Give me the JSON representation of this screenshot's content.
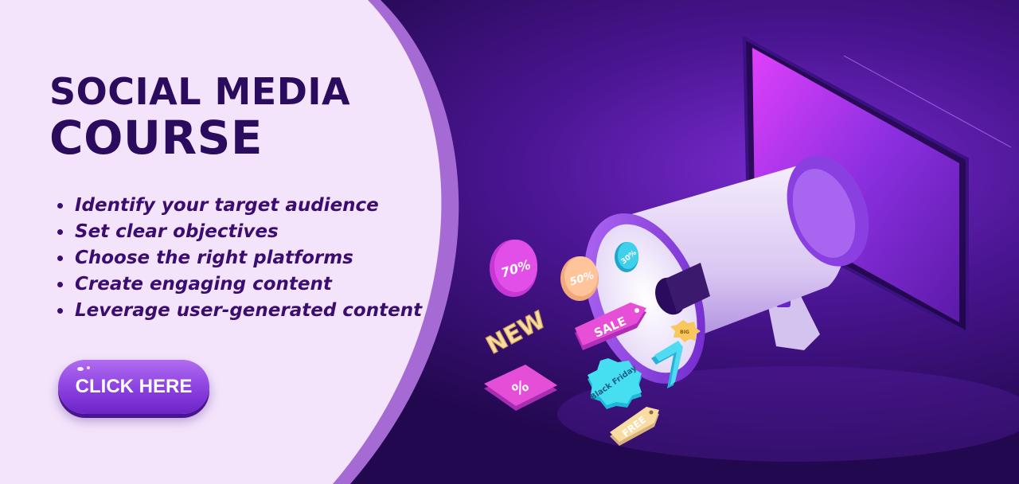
{
  "title": {
    "line1": "SOCIAL MEDIA",
    "line2": "COURSE"
  },
  "features": [
    "Identify your target audience",
    "Set clear objectives",
    "Choose the right platforms",
    "Create engaging content",
    "Leverage user-generated content"
  ],
  "cta": {
    "label": "CLICK HERE"
  },
  "illustration": {
    "badges": [
      "70%",
      "50%",
      "30%",
      "NEW",
      "SALE",
      "%",
      "Black Friday",
      "FREE",
      "BIG"
    ]
  },
  "colors": {
    "panel": "#f3e4fb",
    "panel_edge": "#a56ad3",
    "background": "#2a0a5c",
    "title": "#2b0b5e",
    "button": "#8a3fe0"
  }
}
